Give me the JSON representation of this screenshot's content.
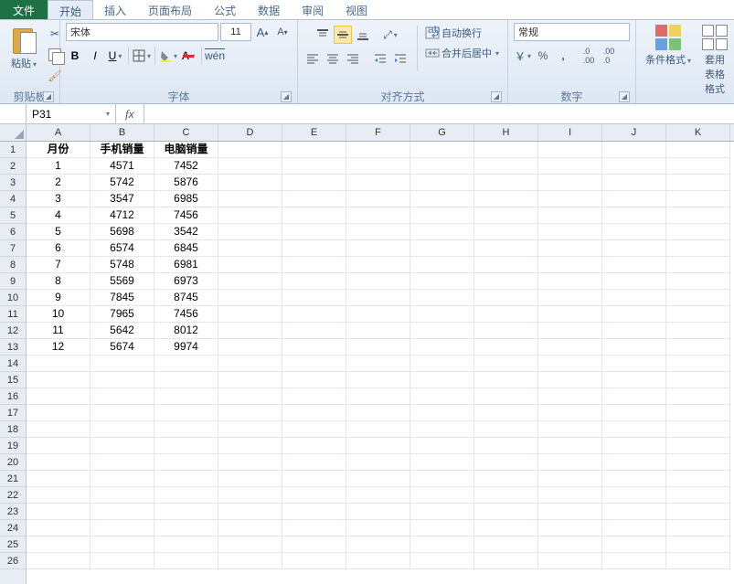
{
  "tabs": {
    "file": "文件",
    "home": "开始",
    "insert": "插入",
    "layout": "页面布局",
    "formula": "公式",
    "data": "数据",
    "review": "审阅",
    "view": "视图"
  },
  "clipboard": {
    "paste": "粘贴",
    "group": "剪贴板"
  },
  "font": {
    "name": "宋体",
    "size": "11",
    "group": "字体"
  },
  "align": {
    "wrap": "自动换行",
    "merge": "合并后居中",
    "group": "对齐方式"
  },
  "number": {
    "format": "常规",
    "group": "数字"
  },
  "styles": {
    "cf": "条件格式",
    "cs": "套用\n表格格式"
  },
  "namebox": "P31",
  "columns": [
    "A",
    "B",
    "C",
    "D",
    "E",
    "F",
    "G",
    "H",
    "I",
    "J",
    "K"
  ],
  "rows": 26,
  "header": [
    "月份",
    "手机销量",
    "电脑销量"
  ],
  "table_data": [
    [
      1,
      4571,
      7452
    ],
    [
      2,
      5742,
      5876
    ],
    [
      3,
      3547,
      6985
    ],
    [
      4,
      4712,
      7456
    ],
    [
      5,
      5698,
      3542
    ],
    [
      6,
      6574,
      6845
    ],
    [
      7,
      5748,
      6981
    ],
    [
      8,
      5569,
      6973
    ],
    [
      9,
      7845,
      8745
    ],
    [
      10,
      7965,
      7456
    ],
    [
      11,
      5642,
      8012
    ],
    [
      12,
      5674,
      9974
    ]
  ],
  "chart_data": {
    "type": "table",
    "title": "",
    "columns": [
      "月份",
      "手机销量",
      "电脑销量"
    ],
    "rows": [
      [
        1,
        4571,
        7452
      ],
      [
        2,
        5742,
        5876
      ],
      [
        3,
        3547,
        6985
      ],
      [
        4,
        4712,
        7456
      ],
      [
        5,
        5698,
        3542
      ],
      [
        6,
        6574,
        6845
      ],
      [
        7,
        5748,
        6981
      ],
      [
        8,
        5569,
        6973
      ],
      [
        9,
        7845,
        8745
      ],
      [
        10,
        7965,
        7456
      ],
      [
        11,
        5642,
        8012
      ],
      [
        12,
        5674,
        9974
      ]
    ]
  }
}
